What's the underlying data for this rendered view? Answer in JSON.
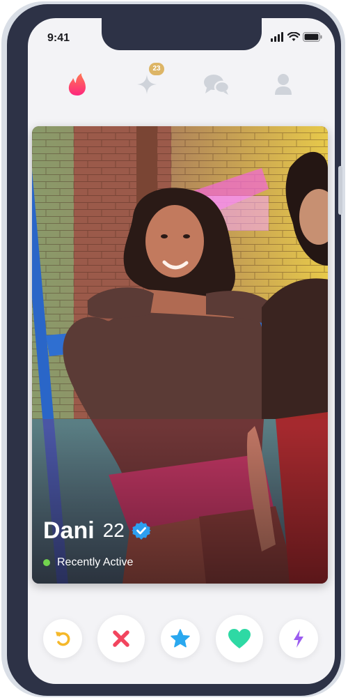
{
  "status_bar": {
    "time": "9:41"
  },
  "nav": {
    "flame": "flame-icon",
    "explore": "sparkle-icon",
    "explore_badge": "23",
    "messages": "chat-icon",
    "profile": "profile-icon"
  },
  "profile": {
    "name": "Dani",
    "age": "22",
    "verified": true,
    "status": "Recently Active",
    "status_color": "#72d44e"
  },
  "actions": [
    {
      "name": "rewind",
      "icon": "rewind-icon",
      "color": "#f5b82a"
    },
    {
      "name": "nope",
      "icon": "close-icon",
      "color": "#f2455e"
    },
    {
      "name": "super-like",
      "icon": "star-icon",
      "color": "#2aa8ef"
    },
    {
      "name": "like",
      "icon": "heart-icon",
      "color": "#2ed9a4"
    },
    {
      "name": "boost",
      "icon": "bolt-icon",
      "color": "#9b5cf0"
    }
  ],
  "colors": {
    "frame": "#2d3246",
    "screen_bg": "#f3f3f6",
    "badge": "#ddb566",
    "flame_gradient": [
      "#fd267d",
      "#ff7854"
    ]
  }
}
